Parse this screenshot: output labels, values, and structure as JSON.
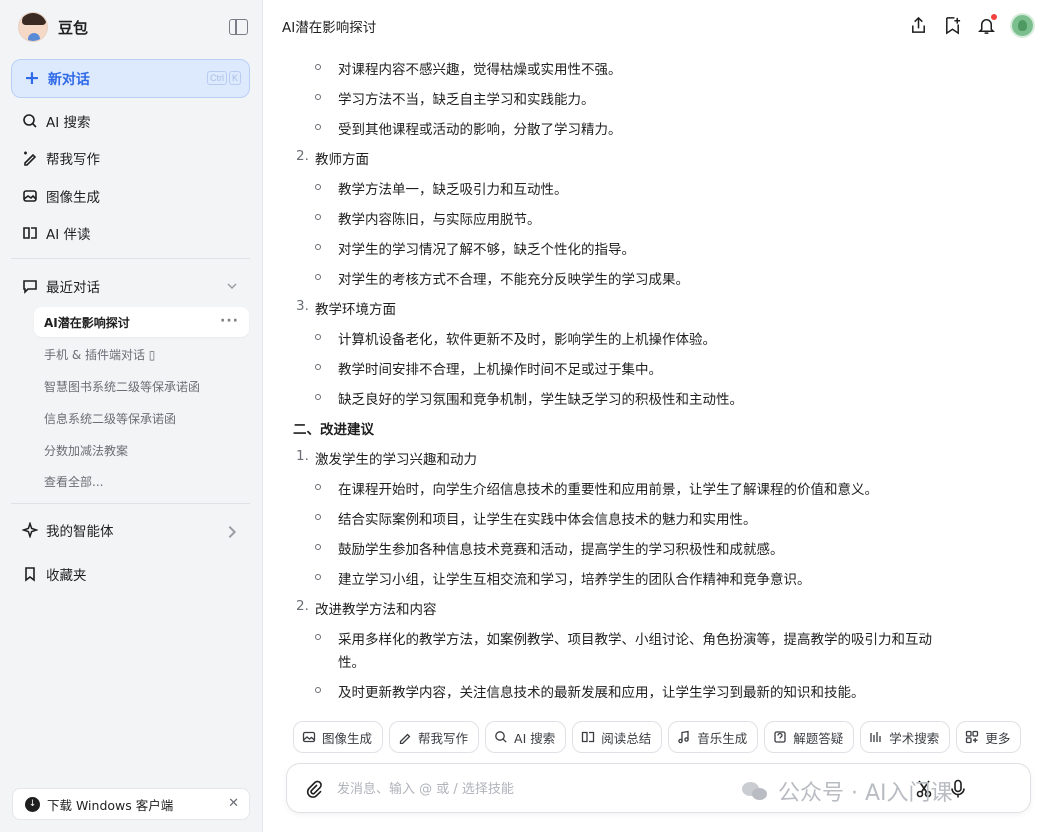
{
  "sidebar": {
    "brand_name": "豆包",
    "new_chat": {
      "label": "新对话",
      "shortcut": [
        "Ctrl",
        "K"
      ]
    },
    "nav": [
      {
        "label": "AI 搜索",
        "icon": "ai-search-icon"
      },
      {
        "label": "帮我写作",
        "icon": "pen-icon"
      },
      {
        "label": "图像生成",
        "icon": "image-icon"
      },
      {
        "label": "AI 伴读",
        "icon": "reading-icon"
      }
    ],
    "recent": {
      "label": "最近对话",
      "items": [
        {
          "label": "AI潜在影响探讨",
          "active": true
        },
        {
          "label": "手机 & 插件端对话 ▯"
        },
        {
          "label": "智慧图书系统二级等保承诺函"
        },
        {
          "label": "信息系统二级等保承诺函"
        },
        {
          "label": "分数加减法教案"
        },
        {
          "label": "查看全部..."
        }
      ]
    },
    "agents_label": "我的智能体",
    "favorites_label": "收藏夹",
    "download_label": "下载 Windows 客户端"
  },
  "header": {
    "title": "AI潜在影响探讨"
  },
  "content": [
    {
      "type": "bullet",
      "text": "对课程内容不感兴趣，觉得枯燥或实用性不强。"
    },
    {
      "type": "bullet",
      "text": "学习方法不当，缺乏自主学习和实践能力。"
    },
    {
      "type": "bullet",
      "text": "受到其他课程或活动的影响，分散了学习精力。"
    },
    {
      "type": "numbered",
      "num": "2.",
      "text": "教师方面"
    },
    {
      "type": "bullet",
      "text": "教学方法单一，缺乏吸引力和互动性。"
    },
    {
      "type": "bullet",
      "text": "教学内容陈旧，与实际应用脱节。"
    },
    {
      "type": "bullet",
      "text": "对学生的学习情况了解不够，缺乏个性化的指导。"
    },
    {
      "type": "bullet",
      "text": "对学生的考核方式不合理，不能充分反映学生的学习成果。"
    },
    {
      "type": "numbered",
      "num": "3.",
      "text": "教学环境方面"
    },
    {
      "type": "bullet",
      "text": "计算机设备老化，软件更新不及时，影响学生的上机操作体验。"
    },
    {
      "type": "bullet",
      "text": "教学时间安排不合理，上机操作时间不足或过于集中。"
    },
    {
      "type": "bullet",
      "text": "缺乏良好的学习氛围和竞争机制，学生缺乏学习的积极性和主动性。"
    },
    {
      "type": "heading",
      "text": "二、改进建议"
    },
    {
      "type": "numbered",
      "num": "1.",
      "text": "激发学生的学习兴趣和动力"
    },
    {
      "type": "bullet",
      "text": "在课程开始时，向学生介绍信息技术的重要性和应用前景，让学生了解课程的价值和意义。"
    },
    {
      "type": "bullet",
      "text": "结合实际案例和项目，让学生在实践中体会信息技术的魅力和实用性。"
    },
    {
      "type": "bullet",
      "text": "鼓励学生参加各种信息技术竞赛和活动，提高学生的学习积极性和成就感。"
    },
    {
      "type": "bullet",
      "text": "建立学习小组，让学生互相交流和学习，培养学生的团队合作精神和竞争意识。"
    },
    {
      "type": "numbered",
      "num": "2.",
      "text": "改进教学方法和内容"
    },
    {
      "type": "bullet",
      "text": "采用多样化的教学方法，如案例教学、项目教学、小组讨论、角色扮演等，提高教学的吸引力和互动",
      "cont": "性。"
    },
    {
      "type": "bullet",
      "text": "及时更新教学内容，关注信息技术的最新发展和应用，让学生学习到最新的知识和技能。"
    }
  ],
  "skills": [
    {
      "label": "图像生成",
      "icon": "image-icon"
    },
    {
      "label": "帮我写作",
      "icon": "pen-icon"
    },
    {
      "label": "AI 搜索",
      "icon": "ai-search-icon"
    },
    {
      "label": "阅读总结",
      "icon": "reading-icon"
    },
    {
      "label": "音乐生成",
      "icon": "music-icon"
    },
    {
      "label": "解题答疑",
      "icon": "question-icon"
    },
    {
      "label": "学术搜索",
      "icon": "academic-icon"
    },
    {
      "label": "更多",
      "icon": "more-grid-icon"
    }
  ],
  "composer": {
    "placeholder": "发消息、输入 @ 或 / 选择技能"
  },
  "watermark": "公众号 · AI入门课",
  "colors": {
    "accent": "#2f6ae8",
    "new_chat_bg": "#dde9fd",
    "sidebar_bg": "#f3f4f6",
    "notification": "#f5403d"
  }
}
